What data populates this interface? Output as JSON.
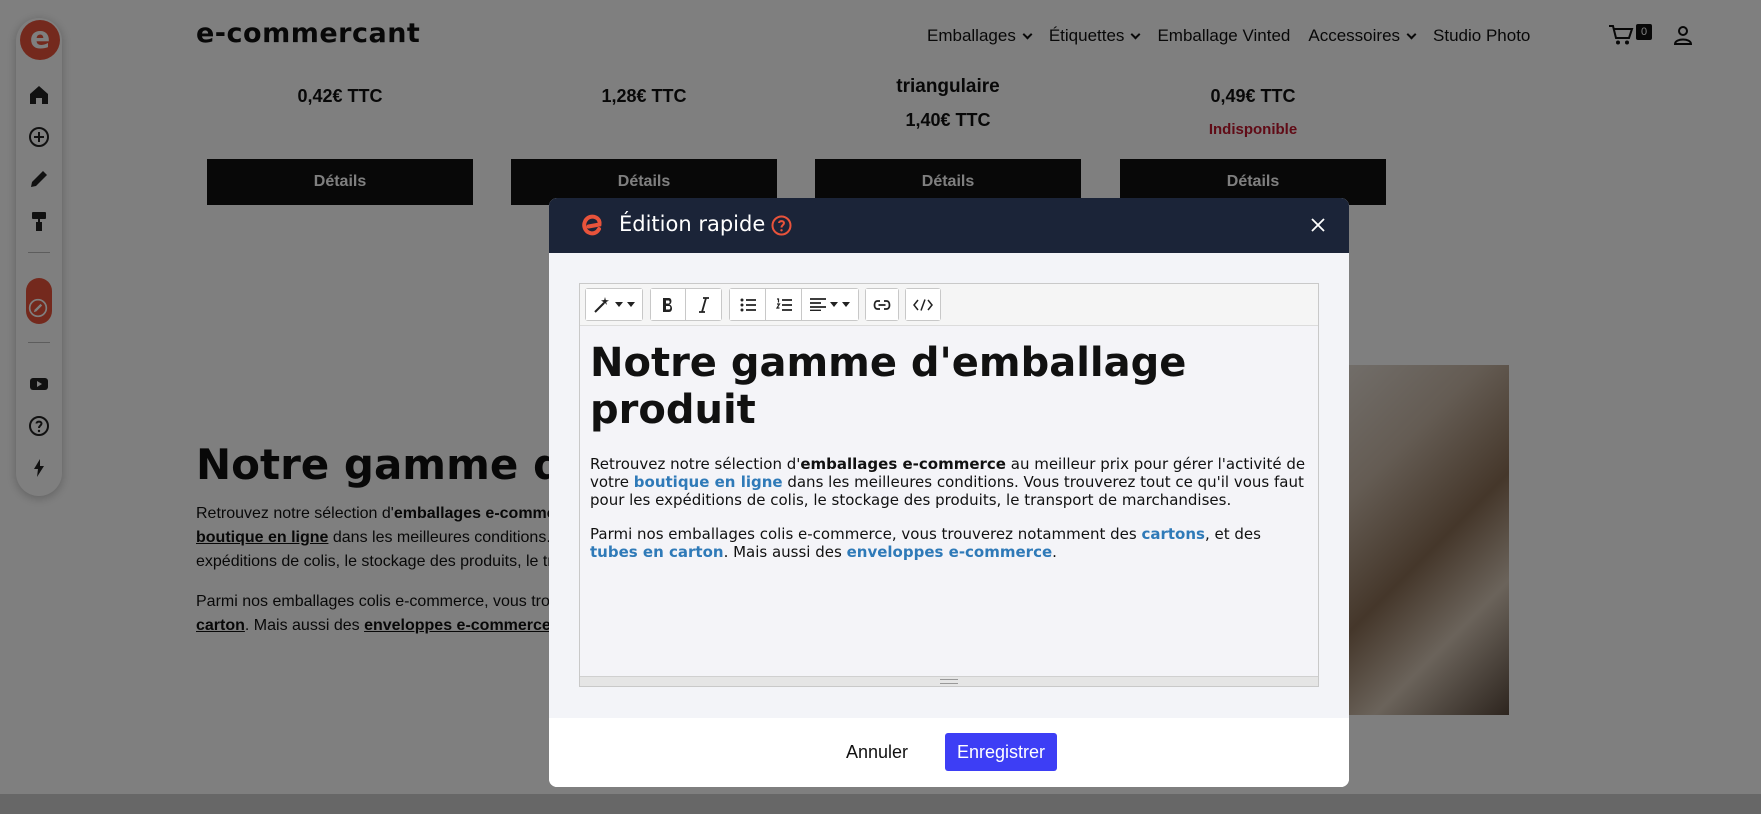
{
  "site": {
    "logo_text": "e-commercant",
    "side_logo_letter": "e",
    "nav": [
      {
        "label": "Emballages"
      },
      {
        "label": "Étiquettes"
      },
      {
        "label": "Emballage Vinted"
      },
      {
        "label": "Accessoires"
      },
      {
        "label": "Studio Photo"
      }
    ],
    "cart_count": "0"
  },
  "products": [
    {
      "price": "0,42€ TTC",
      "button": "Détails"
    },
    {
      "price": "1,28€ TTC",
      "button": "Détails"
    },
    {
      "title_fragment": "triangulaire",
      "price": "1,40€ TTC",
      "button": "Détails"
    },
    {
      "price": "0,49€ TTC",
      "status": "Indisponible",
      "button": "Détails"
    }
  ],
  "background_section": {
    "heading_fragment": "Notre gamme d'e",
    "p1_line1_a": "Retrouvez notre sélection d'",
    "p1_line1_b": "emballages e-comme",
    "p1_line2_link": "boutique en ligne",
    "p1_line2_rest": " dans les meilleures conditions. ",
    "p1_line3": "expéditions de colis, le stockage des produits, le tr",
    "p2_line1": "Parmi nos emballages colis e-commerce, vous tro",
    "p2_line2_link1": "carton",
    "p2_line2_mid": ". Mais aussi des ",
    "p2_line2_link2": "enveloppes e-commerce",
    "p2_line2_end": "."
  },
  "modal": {
    "title": "Édition rapide",
    "cancel_label": "Annuler",
    "save_label": "Enregistrer",
    "editor": {
      "heading": "Notre gamme d'emballage produit",
      "p1_a": "Retrouvez notre sélection d'",
      "p1_b": "emballages e-commerce",
      "p1_c": " au meilleur prix pour gérer l'activité de votre ",
      "p1_link": "boutique en ligne",
      "p1_d": " dans les meilleures conditions. Vous trouverez tout ce qu'il vous faut pour les expéditions de colis, le stockage des produits, le transport de marchandises.",
      "p2_a": "Parmi nos emballages colis e-commerce, vous trouverez notamment des ",
      "p2_link1": "cartons",
      "p2_b": ", et des ",
      "p2_link2": "tubes en carton",
      "p2_c": ". Mais aussi des ",
      "p2_link3": "enveloppes e-commerce",
      "p2_d": "."
    }
  },
  "colors": {
    "brand": "#e8533b",
    "modal_header": "#1b2438",
    "save_button": "#3d3ef5",
    "link": "#2f7ab8",
    "unavailable": "#c0172c"
  }
}
